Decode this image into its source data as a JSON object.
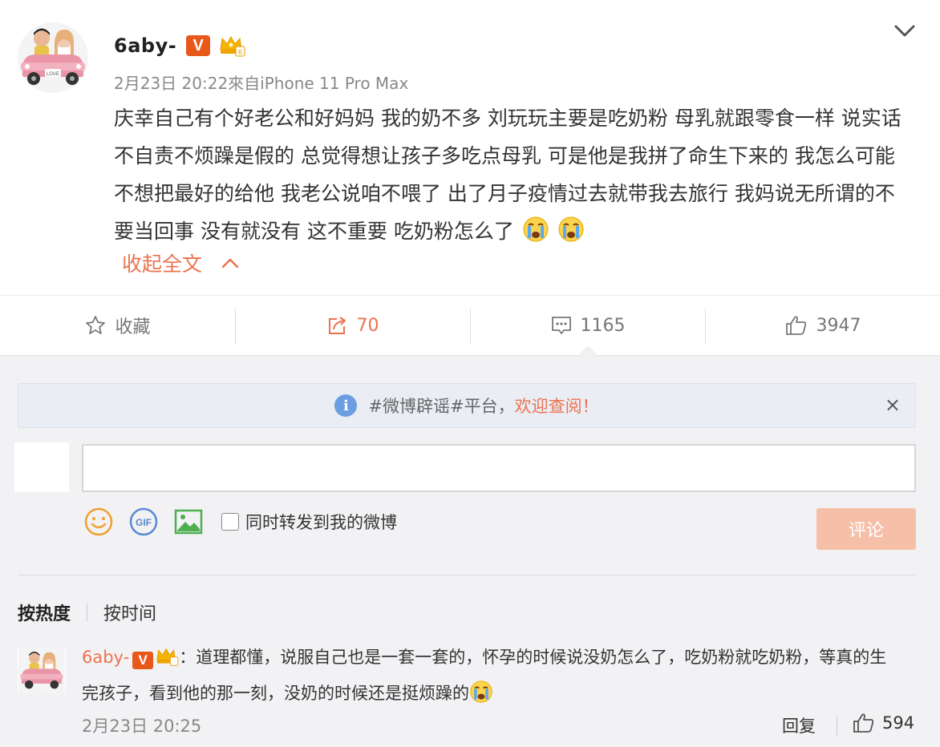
{
  "post": {
    "author": "6aby-",
    "verified_badge": "V",
    "meta": "2月23日 20:22來自iPhone 11 Pro Max",
    "content": "庆幸自己有个好老公和好妈妈 我的奶不多 刘玩玩主要是吃奶粉 母乳就跟零食一样 说实话不自责不烦躁是假的 总觉得想让孩子多吃点母乳 可是他是我拼了命生下来的 我怎么可能不想把最好的给他 我老公说咱不喂了 出了月子疫情过去就带我去旅行 我妈说无所谓的不要当回事 没有就没有 这不重要 吃奶粉怎么了",
    "collapse_label": "收起全文",
    "avatar_sign": "LOVE"
  },
  "actions": {
    "favorite_label": "收藏",
    "repost_count": "70",
    "comment_count": "1165",
    "like_count": "3947"
  },
  "notice": {
    "text": "#微博辟谣#平台，",
    "link": "欢迎查阅！",
    "close": "×"
  },
  "composer": {
    "repost_checkbox_label": "同时转发到我的微博",
    "submit_label": "评论",
    "gif_label": "GIF"
  },
  "sort": {
    "hot": "按热度",
    "time": "按时间"
  },
  "comment": {
    "author": "6aby-",
    "verified_badge": "V",
    "text": "：道理都懂，说服自己也是一套一套的，怀孕的时候说没奶怎么了，吃奶粉就吃奶粉，等真的生完孩子，看到他的那一刻，没奶的时候还是挺烦躁的",
    "time": "2月23日 20:25",
    "reply_label": "回复",
    "like_count": "594"
  },
  "colors": {
    "accent": "#eb7350",
    "verified": "#e8581a",
    "info": "#6a9ee0"
  },
  "icons": [
    "chevron-down-icon",
    "star-icon",
    "repost-icon",
    "comment-icon",
    "thumbs-up-icon",
    "info-icon",
    "close-icon",
    "smiley-icon",
    "gif-icon",
    "image-icon",
    "crying-emoji",
    "crown-icon"
  ]
}
